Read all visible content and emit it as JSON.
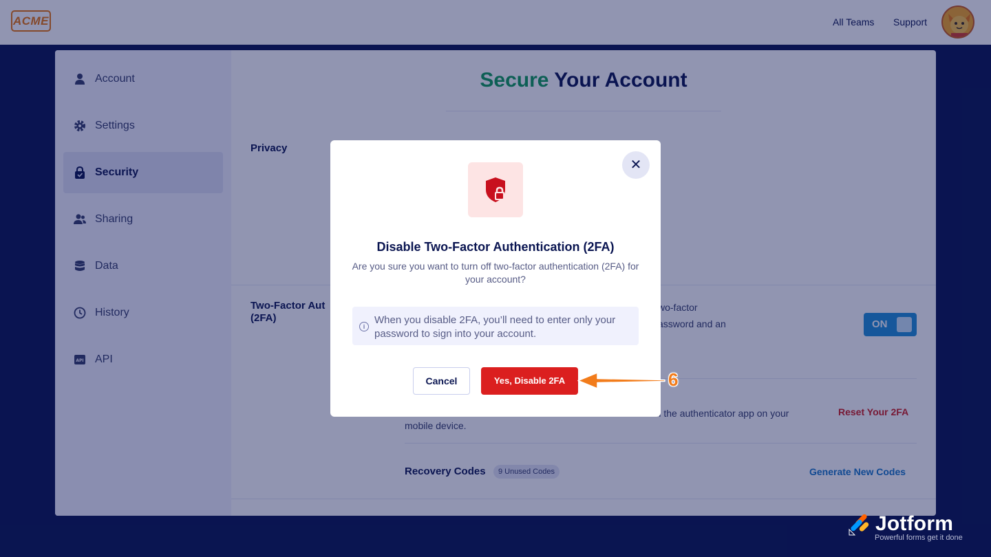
{
  "header": {
    "logo_text": "ACME",
    "nav": [
      "All Teams",
      "Support"
    ]
  },
  "sidebar": {
    "items": [
      {
        "label": "Account",
        "icon": "user-icon"
      },
      {
        "label": "Settings",
        "icon": "gear-icon"
      },
      {
        "label": "Security",
        "icon": "lock-icon",
        "active": true
      },
      {
        "label": "Sharing",
        "icon": "users-icon"
      },
      {
        "label": "Data",
        "icon": "database-icon"
      },
      {
        "label": "History",
        "icon": "history-icon"
      },
      {
        "label": "API",
        "icon": "api-icon"
      }
    ]
  },
  "main": {
    "title_highlight": "Secure",
    "title_rest": "Your Account",
    "privacy_label": "Privacy",
    "twofa_label": "Two-Factor Aut",
    "twofa_label_2": "(2FA)",
    "twofa_desc_1": "wo-factor",
    "twofa_desc_2": "assword and an",
    "toggle_label": "ON",
    "reset_desc_1": "om the authenticator app on your",
    "reset_desc_2": "mobile device.",
    "reset_link": "Reset Your 2FA",
    "recovery_label": "Recovery Codes",
    "recovery_badge": "9 Unused Codes",
    "generate_link": "Generate New Codes"
  },
  "modal": {
    "title": "Disable Two-Factor Authentication (2FA)",
    "description": "Are you sure you want to turn off two-factor authentication (2FA) for your account?",
    "info": "When you disable 2FA, you’ll need to enter only your password to sign into your account.",
    "cancel_label": "Cancel",
    "confirm_label": "Yes, Disable 2FA",
    "close_glyph": "✕"
  },
  "annotation": {
    "step_number": "6"
  },
  "brand": {
    "name": "Jotform",
    "tagline": "Powerful forms get it done"
  },
  "colors": {
    "navy": "#0a1551",
    "accent_green": "#0f9d58",
    "danger": "#db1f1f",
    "toggle_blue": "#1f8ed8",
    "arrow_orange": "#f27c1b"
  }
}
